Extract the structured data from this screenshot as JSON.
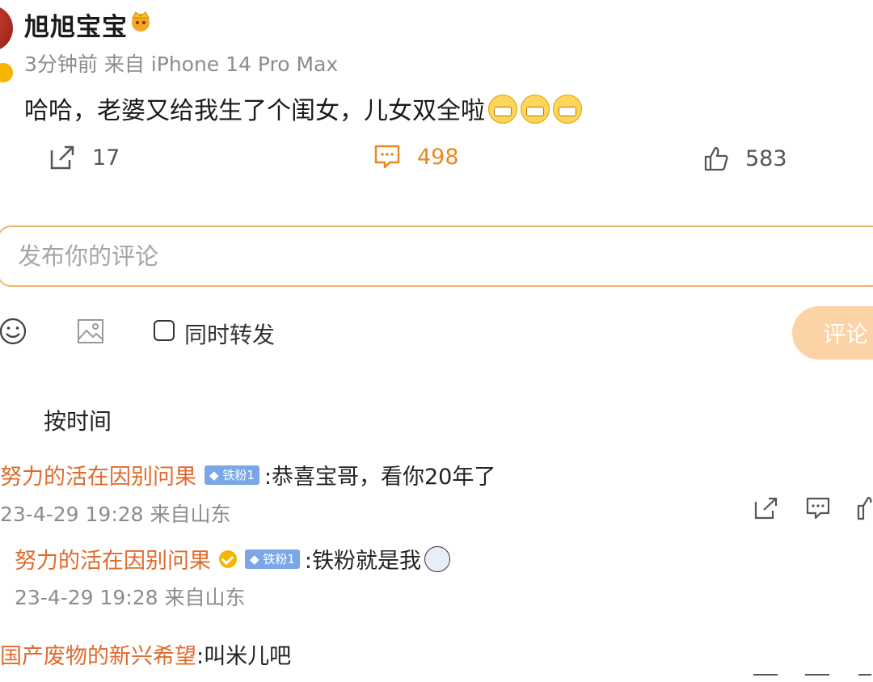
{
  "post": {
    "username": "旭旭宝宝",
    "meta": "3分钟前 来自 iPhone 14 Pro Max",
    "text": "哈哈，老婆又给我生了个闺女，儿女双全啦",
    "shares": "17",
    "comments": "498",
    "likes": "583"
  },
  "composer": {
    "placeholder": "发布你的评论",
    "repost_label": "同时转发",
    "submit_label": "评论"
  },
  "sort_label": "按时间",
  "comments": [
    {
      "name": "努力的活在因别问果",
      "badge": "铁粉1",
      "text": ":恭喜宝哥，看你20年了",
      "meta": "23-4-29 19:28 来自山东"
    },
    {
      "name": "努力的活在因别问果",
      "badge": "铁粉1",
      "text": ":铁粉就是我",
      "meta": "23-4-29 19:28 来自山东"
    },
    {
      "name": "国产废物的新兴希望",
      "text": ":叫米儿吧"
    }
  ],
  "colors": {
    "accent": "#e8891e",
    "name": "#e06b2d",
    "input_border": "#f0b46a",
    "button": "#fcd3a6"
  }
}
